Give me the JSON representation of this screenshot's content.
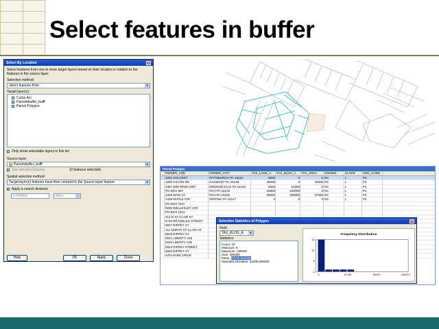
{
  "slide": {
    "title": "Select features in buffer"
  },
  "select_by_location": {
    "title": "Select By Location",
    "description": "Select features from one or more target layers based on their location in relation to the features in the source layer.",
    "selection_method_label": "Selection method:",
    "selection_method_value": "select features from",
    "target_layers_label": "Target layer(s):",
    "target_layers": [
      {
        "name": "Curbs Arc",
        "checked": false
      },
      {
        "name": "Parcelsbuffer_bufff",
        "checked": false
      },
      {
        "name": "Parcel Polygon",
        "checked": true
      }
    ],
    "only_selectable_label": "Only show selectable layers in this list",
    "source_layer_label": "Source layer:",
    "source_layer_value": "Parcelsbuffer_bufff",
    "use_selected_label": "Use selected features",
    "features_selected": "(0 features selected)",
    "spatial_method_label": "Spatial selection method:",
    "spatial_method_value": "Target layer(s) features have their centroid in the Source layer feature",
    "apply_distance_label": "Apply a search distance",
    "distance_value": "0.000000",
    "distance_unit": "Miles",
    "buttons": {
      "help": "Help",
      "ok": "OK",
      "apply": "Apply",
      "close": "Close"
    }
  },
  "parcel_table": {
    "title": "Parcel Polygon",
    "columns": [
      "OWNER_ADD",
      "OWNER_CITY",
      "TAX_LAND_A",
      "TAX_BLDG_A",
      "TAX_AREA",
      "ZONING",
      "SLOPE",
      "ZON_CODE"
    ],
    "rows": [
      [
        "2201 HOLCEST",
        "PITTSBURGH PA 15210",
        "9600",
        "0",
        "0",
        "R4",
        "L",
        "P4"
      ],
      [
        "1295 HILTON RD",
        "OAKMONT PA 15139",
        "35000",
        "0",
        "30000",
        "R4",
        "L",
        "P4"
      ],
      [
        "4357 WM PENN HWY",
        "MONROEVILLE PA 15146",
        "8400",
        "51000",
        "0",
        "R4",
        "L",
        "P4"
      ],
      [
        "PO BOX 597",
        "PGH PA 15219",
        "26800",
        "100000",
        "0",
        "R4",
        "L",
        "P4"
      ],
      [
        "1305 MAIN ST",
        "PGH PA 15215",
        "25000",
        "180000",
        "37000",
        "R4",
        "L",
        "P4"
      ],
      [
        "1409 MAPLE AVE",
        "VERONA PA 15147",
        "0",
        "0",
        "0",
        "R4",
        "L",
        "P4"
      ],
      [
        "PO BOX 7847",
        "",
        "",
        "",
        "",
        "",
        "",
        ""
      ],
      [
        "5835 WELLESLEY AVE",
        "",
        "",
        "",
        "",
        "",
        "",
        ""
      ],
      [
        "PO BOX 2101",
        "",
        "",
        "",
        "",
        "",
        "",
        ""
      ],
      [
        "412 N ST CLAIR ST",
        "",
        "",
        "",
        "",
        "",
        "",
        ""
      ],
      [
        "5726 REYNOLDS STREET",
        "",
        "",
        "",
        "",
        "",
        "",
        ""
      ],
      [
        "5927 RIPPEY ST",
        "",
        "",
        "",
        "",
        "",
        "",
        ""
      ],
      [
        "411 NORTH ST CLAIR ST",
        "",
        "",
        "",
        "",
        "",
        "",
        ""
      ],
      [
        "5929 RIPPEY ST",
        "",
        "",
        "",
        "",
        "",
        "",
        ""
      ],
      [
        "5931 LIBERTY AVE",
        "",
        "",
        "",
        "",
        "",
        "",
        ""
      ],
      [
        "5929 LIBERTY AVE",
        "",
        "",
        "",
        "",
        "",
        "",
        ""
      ],
      [
        "5924 RIPPEY STREET",
        "",
        "",
        "",
        "",
        "",
        "",
        ""
      ],
      [
        "5903 RIPPEY ST",
        "",
        "",
        "",
        "",
        "",
        "",
        ""
      ],
      [
        "4704 PARK DRIVE",
        "",
        "",
        "",
        "",
        "",
        "",
        ""
      ]
    ]
  },
  "selection_stats": {
    "title": "Selection Statistics of Polygon",
    "field_label": "Field",
    "field_value": "TAX_BLDG_A",
    "statistics_label": "Statistics:",
    "stats": [
      {
        "label": "Count:",
        "value": "19"
      },
      {
        "label": "Minimum:",
        "value": "0"
      },
      {
        "label": "Maximum:",
        "value": "180000"
      },
      {
        "label": "Sum:",
        "value": "450300"
      },
      {
        "label": "Mean:",
        "value": "23700.000000"
      },
      {
        "label": "Standard Deviation:",
        "value": "41295.385200"
      }
    ],
    "chart": {
      "title": "Frequency Distribution",
      "y_ticks": [
        "15",
        "10",
        "5",
        "0"
      ],
      "x_ticks": [
        "0",
        "41799",
        "89478",
        "135217"
      ],
      "ymax": 15,
      "bar_values": [
        15,
        1,
        1,
        1,
        1
      ]
    }
  },
  "colors": {
    "accent": "#1a6b6b",
    "map_highlight": "#17b3c4",
    "titlebar": "#0a3fb2"
  }
}
